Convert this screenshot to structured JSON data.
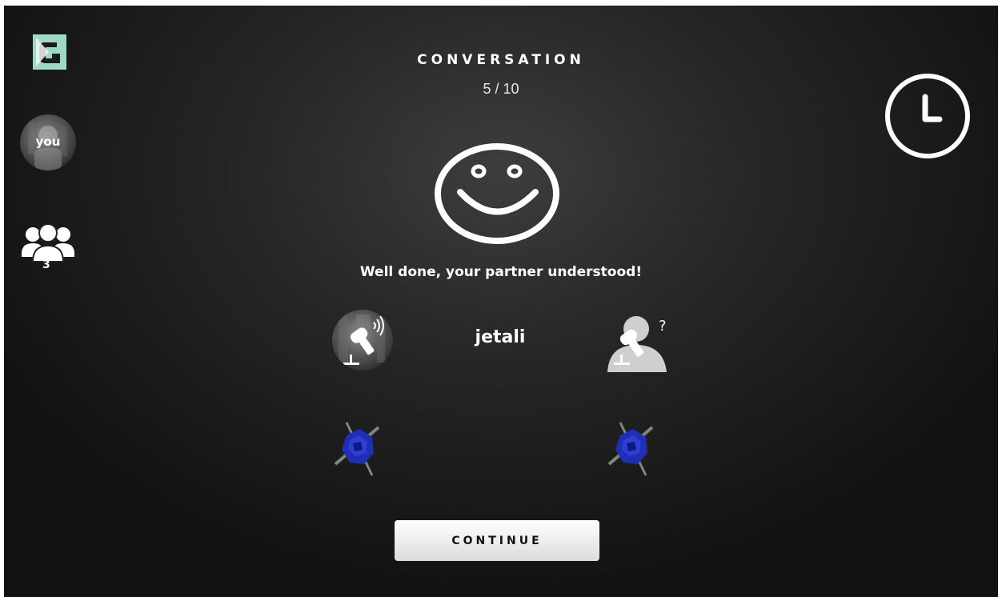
{
  "header": {
    "title": "CONVERSATION",
    "progress": "5 / 10"
  },
  "sidebar": {
    "logo": "app-logo",
    "player_label": "you",
    "group_count": "3"
  },
  "result": {
    "mood_icon": "smiley-icon",
    "message": "Well done, your partner understood!",
    "word": "jetali",
    "speaker_icon": "microphone-speaking-icon",
    "listener_icon": "microphone-question-icon",
    "item_icon": "blue-toy-icon"
  },
  "actions": {
    "continue_label": "CONTINUE"
  },
  "colors": {
    "logo_teal": "#9ed9c8",
    "button_bg": "#f2f2f2",
    "toy_blue": "#1f2fb5"
  }
}
